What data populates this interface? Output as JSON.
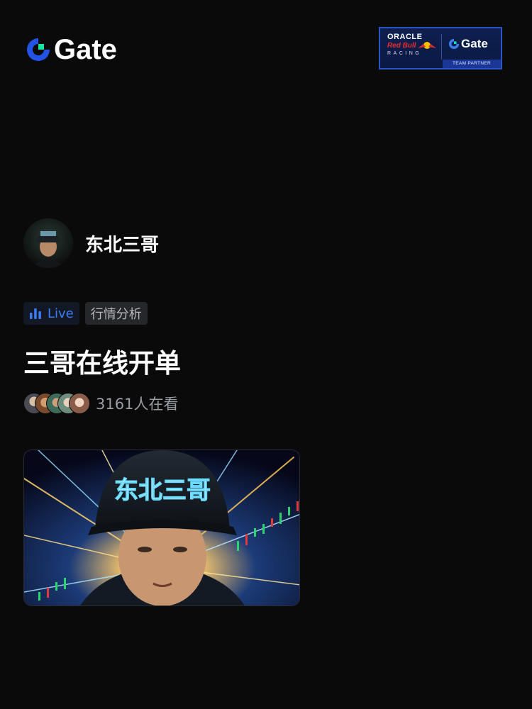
{
  "brand": {
    "name": "Gate",
    "accent": "#2354e6",
    "accent_secondary": "#17e6a1"
  },
  "partner_badge": {
    "line1": "ORACLE",
    "line2": "Red Bull",
    "line3": "RACING",
    "brand": "Gate",
    "footer": "TEAM PARTNER"
  },
  "author": {
    "name": "东北三哥"
  },
  "tags": {
    "live_label": "Live",
    "category": "行情分析"
  },
  "stream": {
    "title": "三哥在线开单",
    "viewer_text": "3161人在看"
  },
  "thumbnail": {
    "cap_text": "东北三哥"
  },
  "colors": {
    "background": "#0a0a0b",
    "live_blue": "#3d7bf0",
    "muted_text": "#9a9ca3"
  },
  "icons": [
    "gate-logo-icon",
    "bar-chart-icon",
    "viewer-avatar-icon"
  ]
}
